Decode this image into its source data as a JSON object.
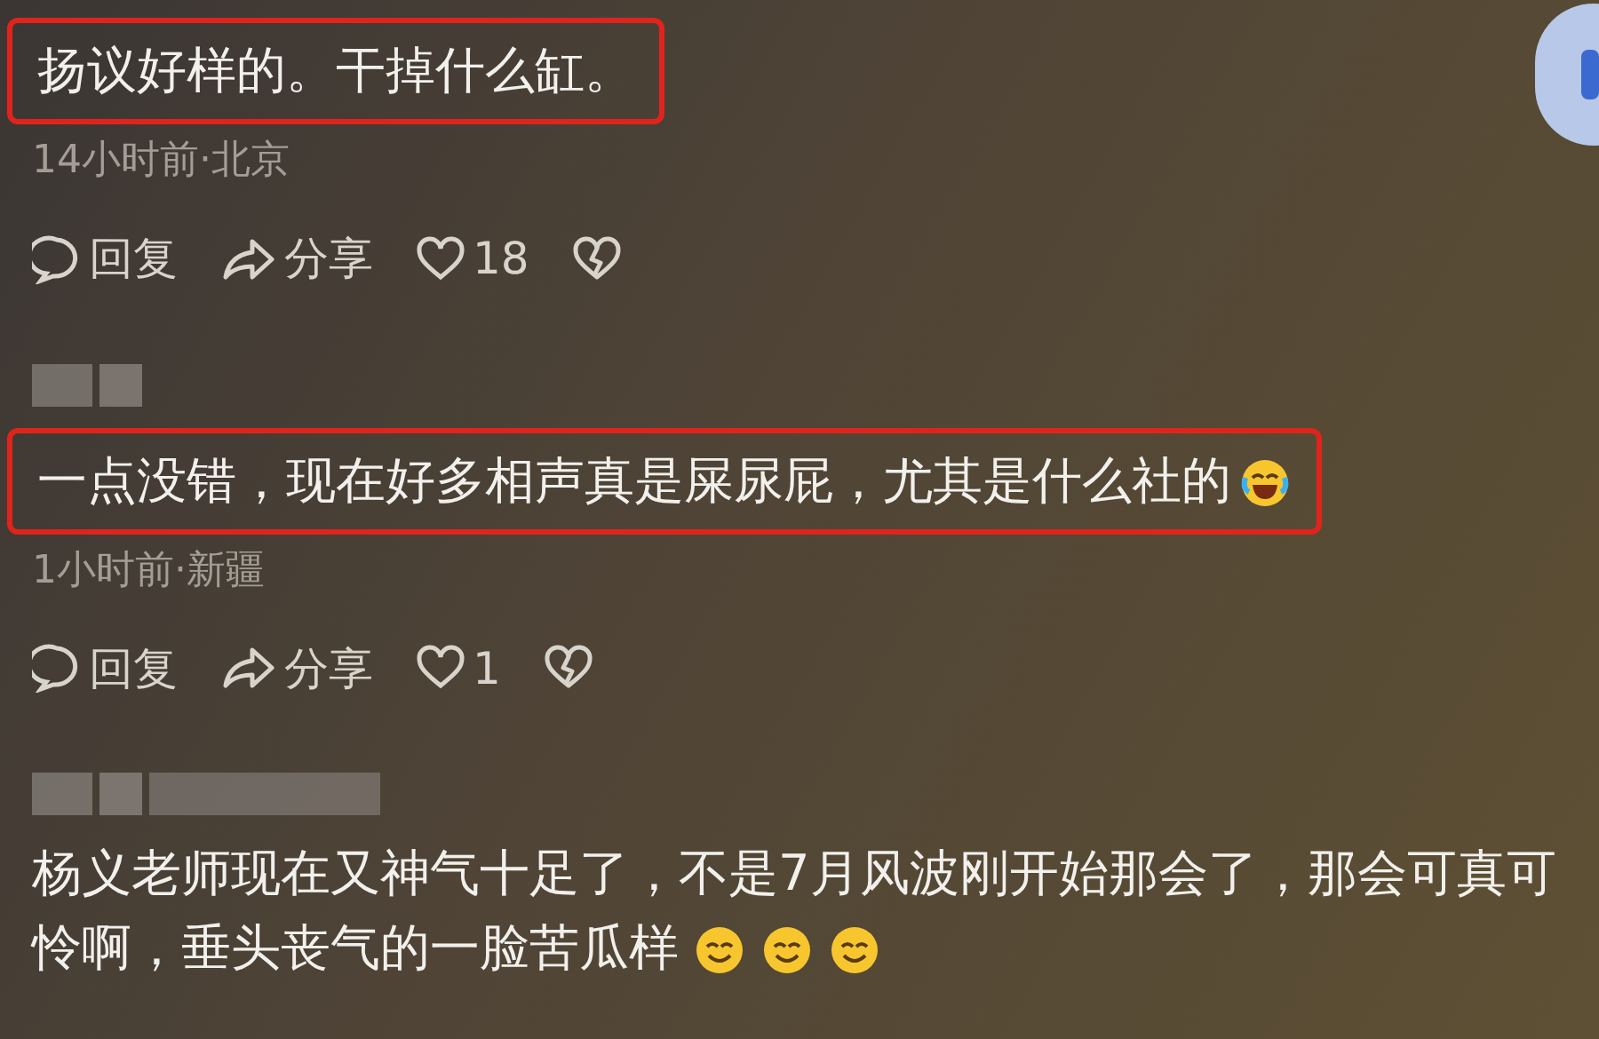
{
  "comments": [
    {
      "text": "扬议好样的。干掉什么缸。",
      "highlighted": true,
      "show_name": false,
      "meta": "14小时前·北京",
      "actions": {
        "reply": "回复",
        "share": "分享",
        "likes": "18"
      }
    },
    {
      "text": "一点没错，现在好多相声真是屎尿屁，尤其是什么社的",
      "highlighted": true,
      "show_name": true,
      "meta": "1小时前·新疆",
      "emojis": [
        {
          "kind": "laugh-cry"
        }
      ],
      "actions": {
        "reply": "回复",
        "share": "分享",
        "likes": "1"
      }
    },
    {
      "text": "杨义老师现在又神气十足了，不是7月风波刚开始那会了，那会可真可怜啊，垂头丧气的一脸苦瓜样",
      "highlighted": false,
      "show_name": true,
      "emojis": [
        {
          "kind": "smile"
        },
        {
          "kind": "smile"
        },
        {
          "kind": "smile"
        }
      ]
    }
  ]
}
